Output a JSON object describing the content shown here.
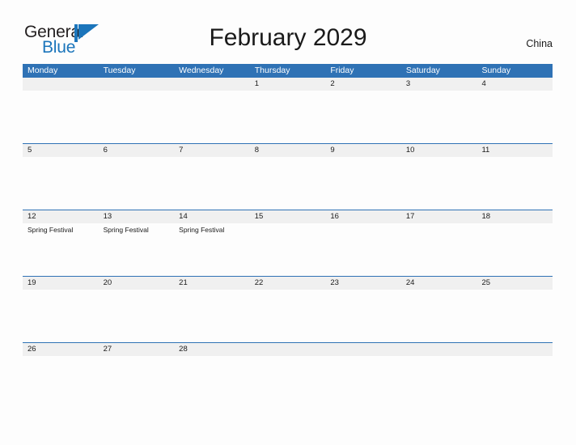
{
  "brand": {
    "name_part1": "General",
    "name_part2": "Blue",
    "color_dark": "#231f20",
    "color_blue": "#1b75bb",
    "mark_icon": "blue-flag-triangle-icon"
  },
  "header": {
    "title": "February 2029",
    "country": "China",
    "header_bg_color": "#2f72b5",
    "header_text_color": "#ffffff"
  },
  "calendar": {
    "day_names": [
      "Monday",
      "Tuesday",
      "Wednesday",
      "Thursday",
      "Friday",
      "Saturday",
      "Sunday"
    ],
    "band_color": "#f0f0f0",
    "rule_color": "#2f72b5",
    "weeks": [
      {
        "dates": [
          "",
          "",
          "",
          "1",
          "2",
          "3",
          "4"
        ],
        "events": [
          "",
          "",
          "",
          "",
          "",
          "",
          ""
        ]
      },
      {
        "dates": [
          "5",
          "6",
          "7",
          "8",
          "9",
          "10",
          "11"
        ],
        "events": [
          "",
          "",
          "",
          "",
          "",
          "",
          ""
        ]
      },
      {
        "dates": [
          "12",
          "13",
          "14",
          "15",
          "16",
          "17",
          "18"
        ],
        "events": [
          "Spring Festival",
          "Spring Festival",
          "Spring Festival",
          "",
          "",
          "",
          ""
        ]
      },
      {
        "dates": [
          "19",
          "20",
          "21",
          "22",
          "23",
          "24",
          "25"
        ],
        "events": [
          "",
          "",
          "",
          "",
          "",
          "",
          ""
        ]
      },
      {
        "dates": [
          "26",
          "27",
          "28",
          "",
          "",
          "",
          ""
        ],
        "events": [
          "",
          "",
          "",
          "",
          "",
          "",
          ""
        ]
      }
    ]
  }
}
